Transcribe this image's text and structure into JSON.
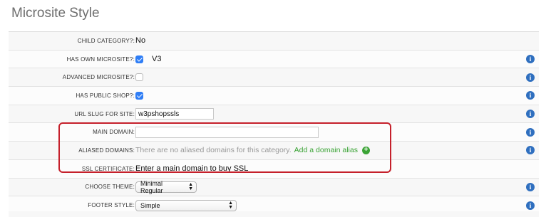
{
  "title": "Microsite Style",
  "rows": {
    "child_category": {
      "label": "CHILD CATEGORY?:",
      "value": "No"
    },
    "has_own_microsite": {
      "label": "HAS OWN MICROSITE?:",
      "checked": true,
      "value": "V3"
    },
    "advanced_microsite": {
      "label": "ADVANCED MICROSITE?:",
      "checked": false
    },
    "has_public_shop": {
      "label": "HAS PUBLIC SHOP?:",
      "checked": true
    },
    "url_slug": {
      "label": "URL SLUG FOR SITE:",
      "value": "w3pshopssls"
    },
    "main_domain": {
      "label": "MAIN DOMAIN:",
      "value": ""
    },
    "aliased_domains": {
      "label": "ALIASED DOMAINS:",
      "empty_text": "There are no aliased domains for this category.",
      "link": "Add a domain alias"
    },
    "ssl_certificate": {
      "label": "SSL CERTIFICATE:",
      "value": "Enter a main domain to buy SSL"
    },
    "choose_theme": {
      "label": "CHOOSE THEME:",
      "selected": "Minimal Regular"
    },
    "footer_style": {
      "label": "FOOTER STYLE:",
      "selected": "Simple"
    }
  },
  "icons": {
    "info": "info-icon",
    "add": "plus-circle-icon"
  },
  "colors": {
    "accent_blue": "#2f6fbf",
    "link_green": "#3aa335",
    "highlight_red": "#c5202b",
    "checkbox_blue": "#2f7ef6"
  }
}
